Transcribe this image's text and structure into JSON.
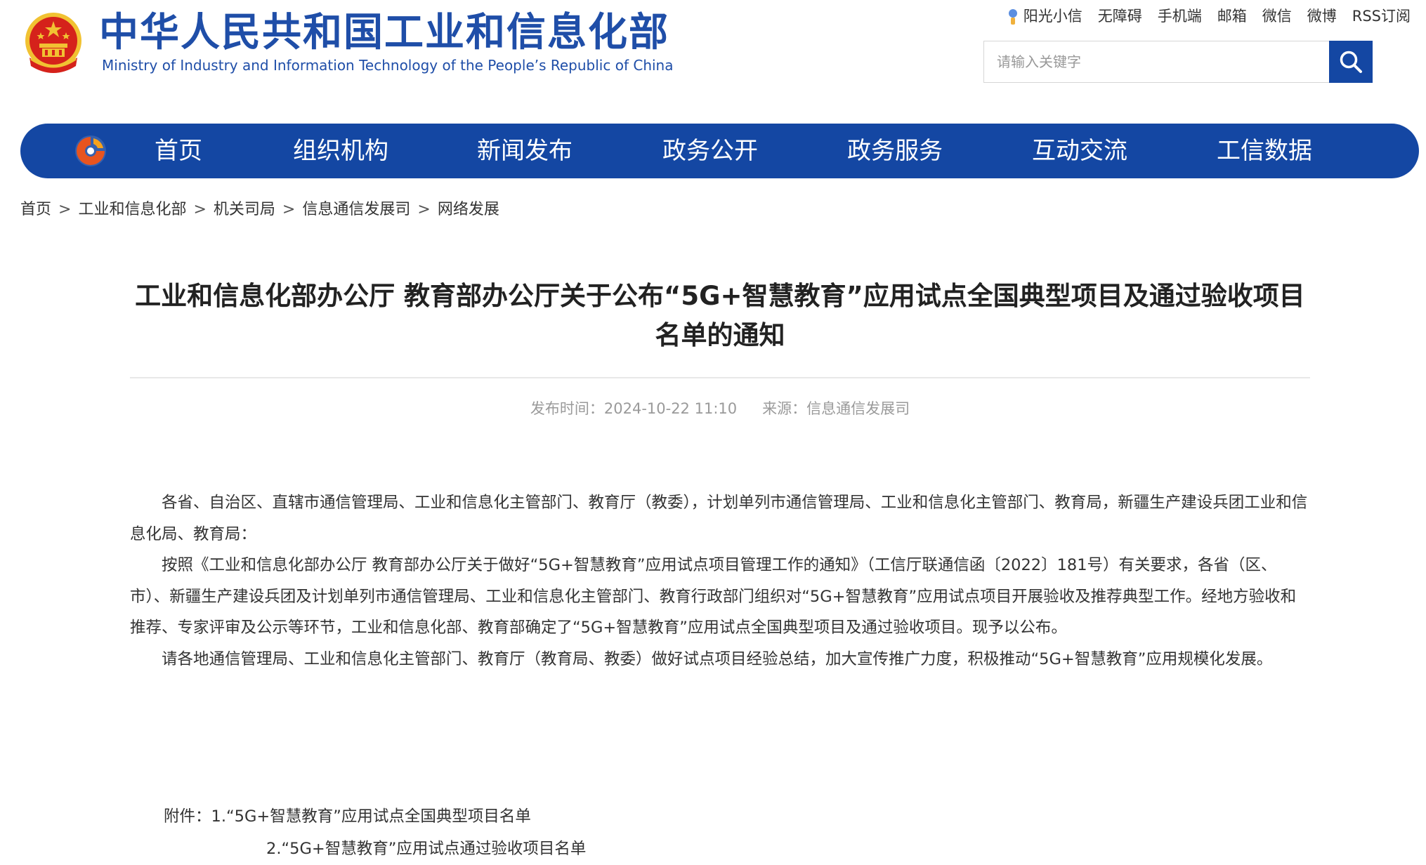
{
  "header": {
    "title_cn": "中华人民共和国工业和信息化部",
    "title_en": "Ministry of Industry and Information Technology of the People’s Republic of China",
    "emblem_icon": "national-emblem-icon"
  },
  "top_links": [
    "阳光小信",
    "无障碍",
    "手机端",
    "邮箱",
    "微信",
    "微博",
    "RSS订阅"
  ],
  "search": {
    "placeholder": "请输入关键字",
    "icon": "search-icon"
  },
  "nav": {
    "logo_icon": "miit-logo-icon",
    "items": [
      "首页",
      "组织机构",
      "新闻发布",
      "政务公开",
      "政务服务",
      "互动交流",
      "工信数据"
    ]
  },
  "breadcrumb": [
    "首页",
    "工业和信息化部",
    "机关司局",
    "信息通信发展司",
    "网络发展"
  ],
  "breadcrumb_separator": ">",
  "article": {
    "title": "工业和信息化部办公厅 教育部办公厅关于公布“5G+智慧教育”应用试点全国典型项目及通过验收项目名单的通知",
    "publish_label": "发布时间：",
    "publish_time": "2024-10-22 11:10",
    "source_label": "来源：",
    "source": "信息通信发展司",
    "paragraphs": [
      "各省、自治区、直辖市通信管理局、工业和信息化主管部门、教育厅（教委），计划单列市通信管理局、工业和信息化主管部门、教育局，新疆生产建设兵团工业和信息化局、教育局：",
      "按照《工业和信息化部办公厅 教育部办公厅关于做好“5G+智慧教育”应用试点项目管理工作的通知》（工信厅联通信函〔2022〕181号）有关要求，各省（区、市）、新疆生产建设兵团及计划单列市通信管理局、工业和信息化主管部门、教育行政部门组织对“5G+智慧教育”应用试点项目开展验收及推荐典型工作。经地方验收和推荐、专家评审及公示等环节，工业和信息化部、教育部确定了“5G+智慧教育”应用试点全国典型项目及通过验收项目。现予以公布。",
      "请各地通信管理局、工业和信息化主管部门、教育厅（教育局、教委）做好试点项目经验总结，加大宣传推广力度，积极推动“5G+智慧教育”应用规模化发展。"
    ],
    "attachments": [
      "附件：1.“5G+智慧教育”应用试点全国典型项目名单",
      "2.“5G+智慧教育”应用试点通过验收项目名单"
    ]
  },
  "colors": {
    "brand_blue": "#1447a3",
    "title_blue": "#1f4ea8",
    "emblem_red": "#d5221b",
    "emblem_gold": "#f1c232"
  }
}
